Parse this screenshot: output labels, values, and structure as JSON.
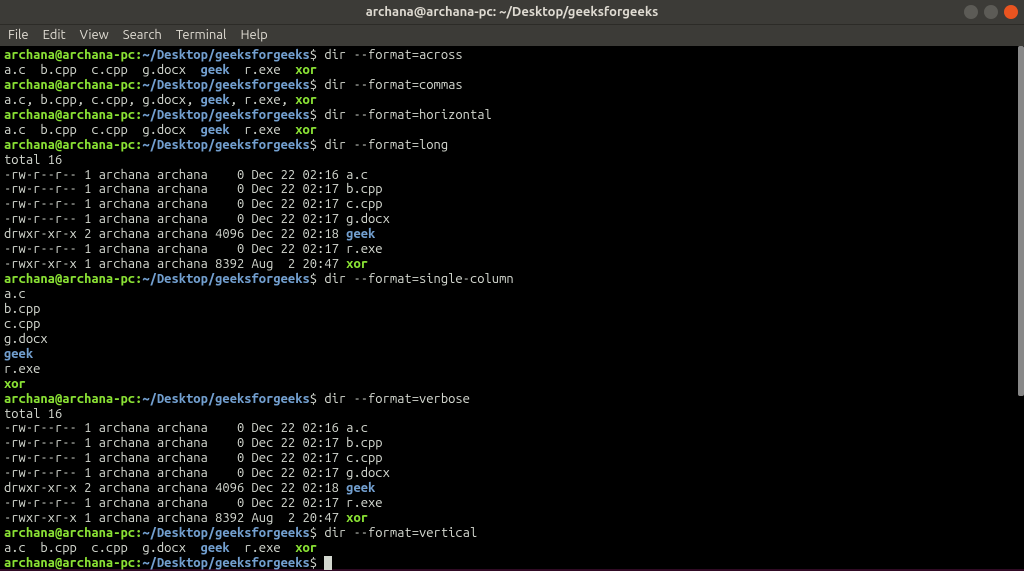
{
  "titlebar": {
    "title": "archana@archana-pc: ~/Desktop/geeksforgeeks"
  },
  "menubar": {
    "items": [
      "File",
      "Edit",
      "View",
      "Search",
      "Terminal",
      "Help"
    ]
  },
  "prompt": {
    "user_host": "archana@archana-pc",
    "colon": ":",
    "path": "~/Desktop/geeksforgeeks",
    "dollar": "$"
  },
  "commands": {
    "across": "dir --format=across",
    "commas": "dir --format=commas",
    "horizontal": "dir --format=horizontal",
    "long": "dir --format=long",
    "single": "dir --format=single-column",
    "verbose": "dir --format=verbose",
    "vertical": "dir --format=vertical"
  },
  "output": {
    "across_files": "a.c  b.cpp  c.cpp  g.docx  ",
    "across_geek": "geek",
    "across_rest": "  r.exe  ",
    "across_xor": "xor",
    "commas_line": "a.c, b.cpp, c.cpp, g.docx, ",
    "commas_geek": "geek",
    "commas_rest": ", r.exe, ",
    "commas_xor": "xor",
    "total": "total 16",
    "long_rows": [
      {
        "perm": "-rw-r--r-- 1 archana archana    0 Dec 22 02:16 ",
        "name": "a.c",
        "class": "out-plain"
      },
      {
        "perm": "-rw-r--r-- 1 archana archana    0 Dec 22 02:17 ",
        "name": "b.cpp",
        "class": "out-plain"
      },
      {
        "perm": "-rw-r--r-- 1 archana archana    0 Dec 22 02:17 ",
        "name": "c.cpp",
        "class": "out-plain"
      },
      {
        "perm": "-rw-r--r-- 1 archana archana    0 Dec 22 02:17 ",
        "name": "g.docx",
        "class": "out-plain"
      },
      {
        "perm": "drwxr-xr-x 2 archana archana 4096 Dec 22 02:18 ",
        "name": "geek",
        "class": "out-blue"
      },
      {
        "perm": "-rw-r--r-- 1 archana archana    0 Dec 22 02:17 ",
        "name": "r.exe",
        "class": "out-plain"
      },
      {
        "perm": "-rwxr-xr-x 1 archana archana 8392 Aug  2 20:47 ",
        "name": "xor",
        "class": "out-green"
      }
    ],
    "single_col": [
      {
        "name": "a.c",
        "class": "out-plain"
      },
      {
        "name": "b.cpp",
        "class": "out-plain"
      },
      {
        "name": "c.cpp",
        "class": "out-plain"
      },
      {
        "name": "g.docx",
        "class": "out-plain"
      },
      {
        "name": "geek",
        "class": "out-blue"
      },
      {
        "name": "r.exe",
        "class": "out-plain"
      },
      {
        "name": "xor",
        "class": "out-green"
      }
    ]
  }
}
